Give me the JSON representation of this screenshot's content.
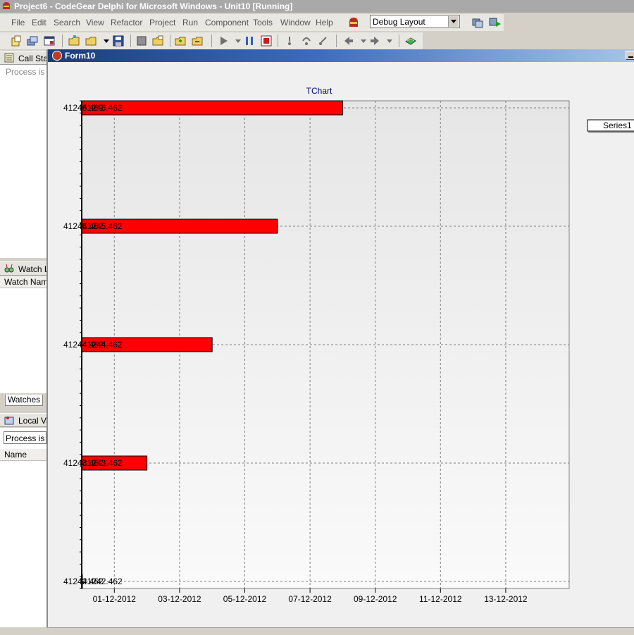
{
  "ide": {
    "title": "Project6 - CodeGear Delphi for Microsoft Windows - Unit10 [Running]",
    "menu": [
      "File",
      "Edit",
      "Search",
      "View",
      "Refactor",
      "Project",
      "Run",
      "Component",
      "Tools",
      "Window",
      "Help"
    ],
    "layout_combo": "Debug Layout"
  },
  "panels": {
    "call_stack": {
      "title": "Call Stac",
      "status": "Process is no"
    },
    "watch_list": {
      "title": "Watch L",
      "column": "Watch Name"
    },
    "watches_tab": "Watches",
    "local_vars": {
      "title": "Local Va",
      "status": "Process is no",
      "column": "Name"
    }
  },
  "form": {
    "title": "Form10"
  },
  "chart_data": {
    "type": "bar",
    "orientation": "horizontal",
    "title": "TChart",
    "legend": {
      "placement": "top-right",
      "entries": [
        "Series1"
      ]
    },
    "grid": true,
    "series": [
      {
        "name": "Series1",
        "color": "#ff0000",
        "points": [
          {
            "y_label": "41242.462",
            "x_label": "41242.462",
            "x": "2012-11-30"
          },
          {
            "y_label": "41243.462",
            "x_label": "41243.462",
            "x": "2012-12-02"
          },
          {
            "y_label": "41244.462",
            "x_label": "41244.462",
            "x": "2012-12-04"
          },
          {
            "y_label": "41245.462",
            "x_label": "41245.462",
            "x": "2012-12-06"
          },
          {
            "y_label": "41246.462",
            "x_label": "41246.462",
            "x": "2012-12-08"
          }
        ]
      }
    ],
    "x_axis": {
      "ticks": [
        "01-12-2012",
        "03-12-2012",
        "05-12-2012",
        "07-12-2012",
        "09-12-2012",
        "11-12-2012",
        "13-12-2012"
      ]
    }
  }
}
